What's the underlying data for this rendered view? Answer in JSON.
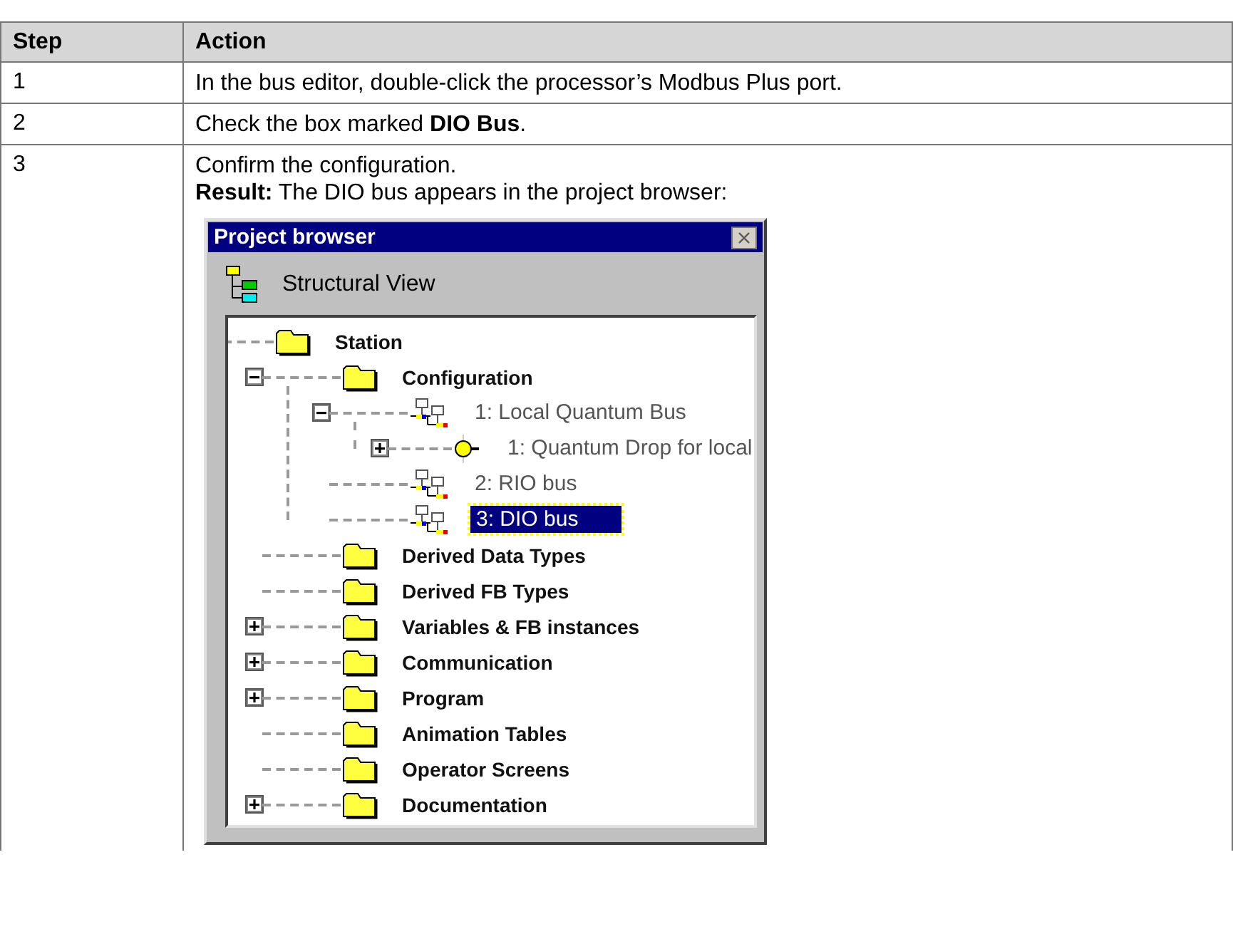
{
  "table": {
    "columns": [
      "Step",
      "Action"
    ],
    "rows": [
      {
        "step": "1",
        "lines": [
          "In the bus editor, double-click the processor’s Modbus Plus port."
        ]
      },
      {
        "step": "2",
        "lines": [
          "Check the box marked **DIO Bus**."
        ]
      },
      {
        "step": "3",
        "lines": [
          "Confirm the configuration.",
          "**Result:** The DIO bus appears in the project browser:"
        ],
        "window": {
          "title": "Project browser",
          "view_label": "Structural View",
          "tree": [
            {
              "label": "Station",
              "kind": "folder",
              "expandable": false,
              "selected": false,
              "children": [
                {
                  "label": "Configuration",
                  "kind": "folder",
                  "expandable": true,
                  "expanded": true,
                  "selected": false,
                  "children": [
                    {
                      "label": "1: Local Quantum Bus",
                      "kind": "bus",
                      "expandable": true,
                      "expanded": true,
                      "selected": false,
                      "children": [
                        {
                          "label": "1: Quantum Drop for local",
                          "kind": "drop",
                          "expandable": true,
                          "expanded": false,
                          "selected": false
                        }
                      ]
                    },
                    {
                      "label": "2: RIO bus",
                      "kind": "bus",
                      "expandable": false,
                      "selected": false
                    },
                    {
                      "label": "3: DIO bus",
                      "kind": "bus",
                      "expandable": false,
                      "selected": true
                    }
                  ]
                },
                {
                  "label": "Derived Data Types",
                  "kind": "folder",
                  "expandable": false,
                  "selected": false
                },
                {
                  "label": "Derived FB Types",
                  "kind": "folder",
                  "expandable": false,
                  "selected": false
                },
                {
                  "label": "Variables & FB instances",
                  "kind": "folder",
                  "expandable": true,
                  "expanded": false,
                  "selected": false
                },
                {
                  "label": "Communication",
                  "kind": "folder",
                  "expandable": true,
                  "expanded": false,
                  "selected": false
                },
                {
                  "label": "Program",
                  "kind": "folder",
                  "expandable": true,
                  "expanded": false,
                  "selected": false
                },
                {
                  "label": "Animation Tables",
                  "kind": "folder",
                  "expandable": false,
                  "selected": false
                },
                {
                  "label": "Operator Screens",
                  "kind": "folder",
                  "expandable": false,
                  "selected": false
                },
                {
                  "label": "Documentation",
                  "kind": "folder",
                  "expandable": true,
                  "expanded": false,
                  "selected": false
                }
              ]
            }
          ]
        }
      }
    ]
  }
}
